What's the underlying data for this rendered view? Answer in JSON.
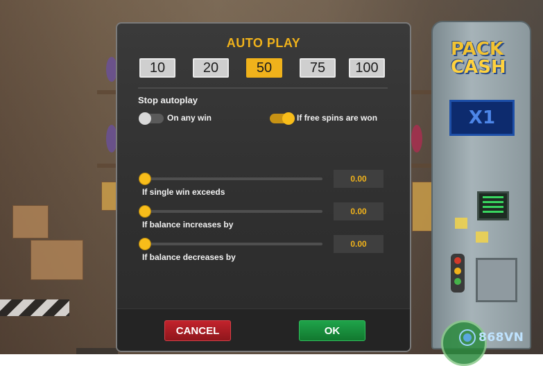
{
  "dialog": {
    "title": "AUTO PLAY",
    "spin_counts": [
      {
        "label": "10",
        "selected": false
      },
      {
        "label": "20",
        "selected": false
      },
      {
        "label": "50",
        "selected": true
      },
      {
        "label": "75",
        "selected": false
      },
      {
        "label": "100",
        "selected": false
      }
    ],
    "stop_autoplay_label": "Stop autoplay",
    "toggles": [
      {
        "label": "On any win",
        "on": false
      },
      {
        "label": "If free spins are won",
        "on": true
      }
    ],
    "sliders": [
      {
        "label": "If single win exceeds",
        "value": "0.00",
        "level": 0
      },
      {
        "label": "If balance increases by",
        "value": "0.00",
        "level": 0
      },
      {
        "label": "If balance decreases by",
        "value": "0.00",
        "level": 0
      }
    ],
    "buttons": {
      "cancel": "CANCEL",
      "ok": "OK"
    }
  },
  "background": {
    "logo_line1": "PACK",
    "logo_line2": "CASH",
    "multiplier": "X1",
    "watermark": "868VN"
  },
  "colors": {
    "accent": "#f0b21b",
    "cancel": "#c2232c",
    "ok": "#1fa34a"
  }
}
